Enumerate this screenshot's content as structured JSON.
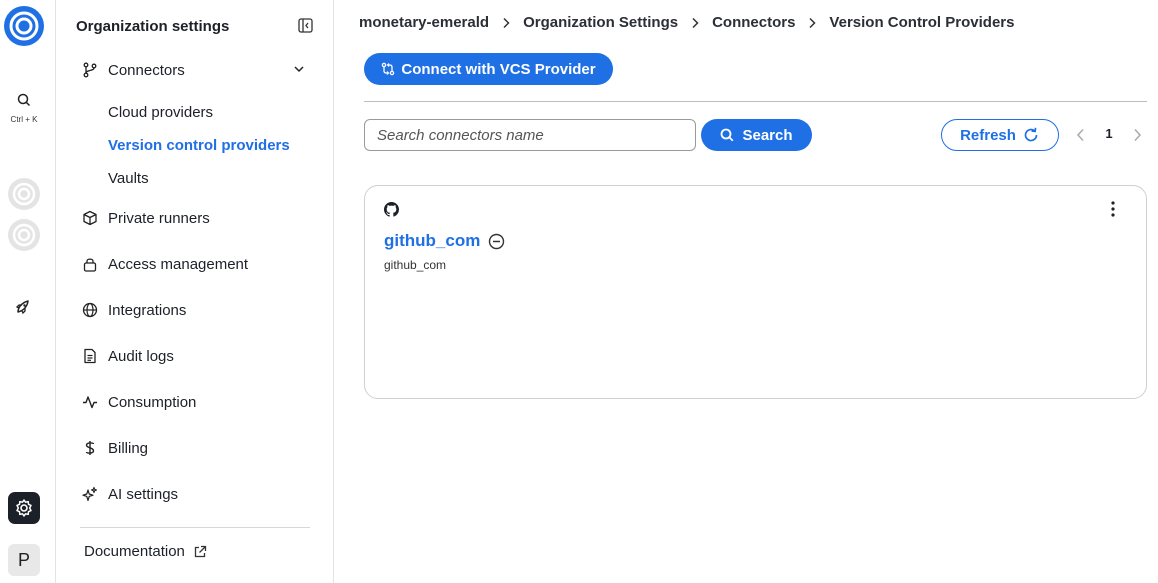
{
  "rail": {
    "search_shortcut": "Ctrl + K",
    "avatar_letter": "P",
    "icons": [
      "logo-icon",
      "search-icon",
      "org-icon",
      "org-icon",
      "rocket-icon",
      "gear-icon"
    ]
  },
  "sidebar": {
    "title": "Organization settings",
    "items": [
      {
        "label": "Connectors",
        "icon": "connector-icon"
      },
      {
        "label": "Private runners",
        "icon": "cube-icon"
      },
      {
        "label": "Access management",
        "icon": "lock-icon"
      },
      {
        "label": "Integrations",
        "icon": "globe-icon"
      },
      {
        "label": "Audit logs",
        "icon": "document-icon"
      },
      {
        "label": "Consumption",
        "icon": "activity-icon"
      },
      {
        "label": "Billing",
        "icon": "dollar-icon"
      },
      {
        "label": "AI settings",
        "icon": "sparkles-icon"
      }
    ],
    "connectors_sub": [
      "Cloud providers",
      "Version control providers",
      "Vaults"
    ],
    "active_sub": "Version control providers",
    "documentation": "Documentation"
  },
  "breadcrumb": [
    "monetary-emerald",
    "Organization Settings",
    "Connectors",
    "Version Control Providers"
  ],
  "toolbar": {
    "connect_label": "Connect with VCS Provider",
    "search_placeholder": "Search connectors name",
    "search_value": "",
    "search_label": "Search",
    "refresh_label": "Refresh",
    "page": "1"
  },
  "connectors": [
    {
      "name": "github_com",
      "description": "github_com",
      "provider_icon": "github-icon"
    }
  ],
  "colors": {
    "accent": "#1f6fe5",
    "dark": "#1c2028"
  }
}
